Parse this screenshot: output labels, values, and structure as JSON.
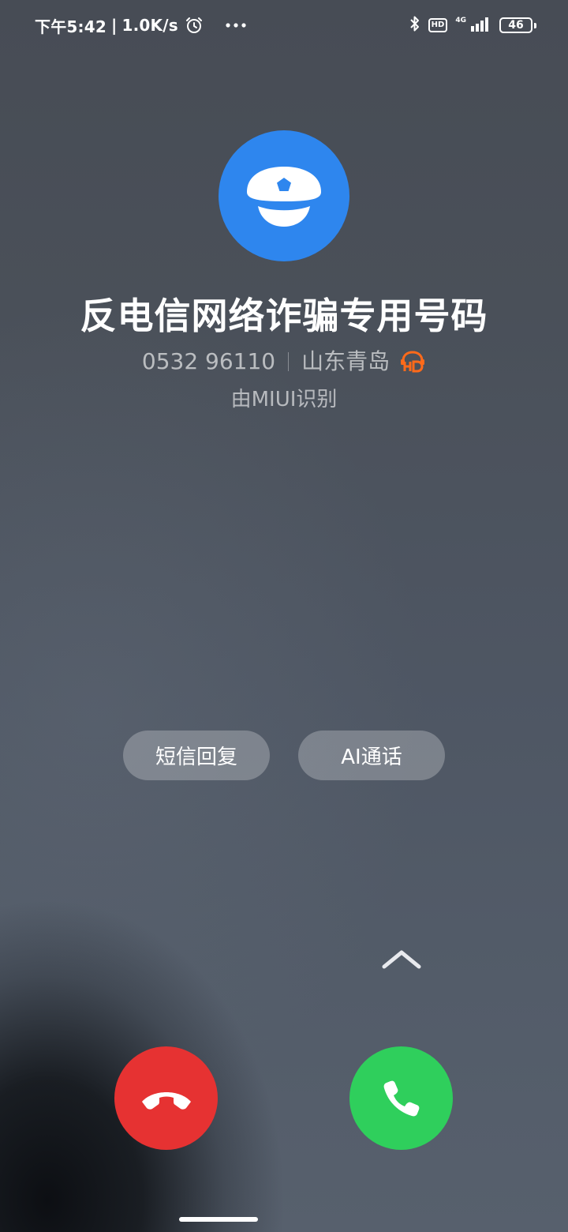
{
  "status_bar": {
    "time": "下午5:42",
    "separator": "|",
    "network_speed": "1.0K/s",
    "network_type": "4G",
    "hd_label": "HD",
    "battery_level": "46"
  },
  "caller": {
    "name": "反电信网络诈骗专用号码",
    "number": "0532 96110",
    "location": "山东青岛",
    "identified_by": "由MIUI识别",
    "avatar_icon": "police-cap-icon",
    "avatar_color": "#2e86ee",
    "hd_voice_color": "#ff6a1a"
  },
  "actions": {
    "sms_reply": "短信回复",
    "ai_call": "AI通话"
  },
  "buttons": {
    "decline_icon": "hang-up-icon",
    "decline_color": "#e63232",
    "answer_icon": "phone-icon",
    "answer_color": "#2fcf5c"
  }
}
